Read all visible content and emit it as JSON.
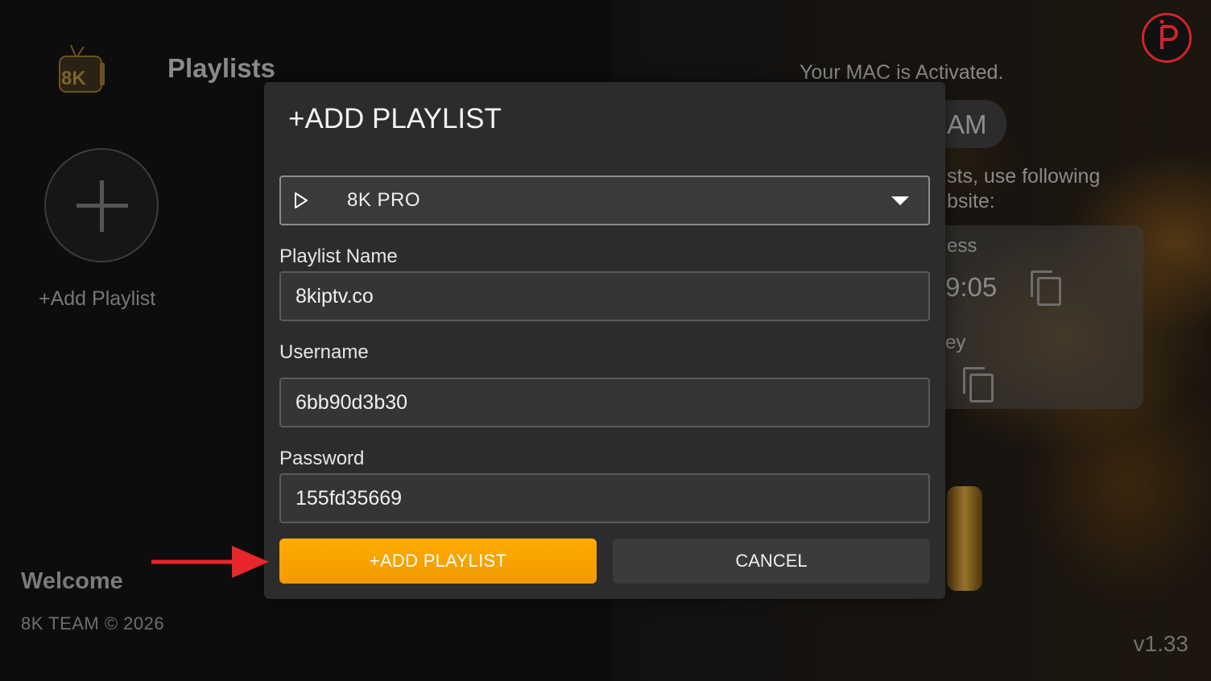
{
  "app": {
    "logo_text": "8K",
    "page_title": "Playlists",
    "add_playlist_label": "+Add Playlist",
    "welcome": "Welcome",
    "copyright": "8K TEAM © 2026",
    "version": "v1.33"
  },
  "background_panel": {
    "mac_status": "Your MAC is Activated.",
    "time_fragment": "AM",
    "instructions_line1": "sts, use following",
    "instructions_line2": "bsite:",
    "card_label_1": "ess",
    "card_value_1": "9:05",
    "card_label_2": "ey"
  },
  "modal": {
    "title": "+ADD PLAYLIST",
    "type_select": {
      "value": "8K PRO",
      "icon": "play-icon"
    },
    "fields": {
      "playlist_name": {
        "label": "Playlist Name",
        "value": "8kiptv.co"
      },
      "username": {
        "label": "Username",
        "value": "6bb90d3b30"
      },
      "password": {
        "label": "Password",
        "value": "155fd35669"
      }
    },
    "buttons": {
      "add": "+ADD PLAYLIST",
      "cancel": "CANCEL"
    }
  },
  "colors": {
    "accent": "#ffab00",
    "modal_bg": "#2c2c2c",
    "annotation_arrow": "#e8262b",
    "badge": "#d2232a"
  }
}
